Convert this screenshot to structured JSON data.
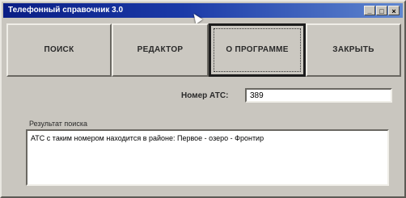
{
  "window": {
    "title": "Телефонный справочник 3.0",
    "controls": {
      "minimize_glyph": "_",
      "maximize_glyph": "□",
      "close_glyph": "×"
    }
  },
  "toolbar": {
    "search_label": "ПОИСК",
    "editor_label": "РЕДАКТОР",
    "about_label": "О ПРОГРАММЕ",
    "close_label": "ЗАКРЫТЬ",
    "active_button": "О ПРОГРАММЕ"
  },
  "form": {
    "ats_label": "Номер АТС:",
    "ats_value": "389",
    "result_label": "Результат поиска",
    "result_text": "АТС с таким номером находится в районе: Первое - озеро - Фронтир"
  },
  "colors": {
    "window_bg": "#c9c6bf",
    "titlebar_start": "#0a1e85",
    "titlebar_end": "#5f86cf",
    "title_text": "#ffffff"
  }
}
